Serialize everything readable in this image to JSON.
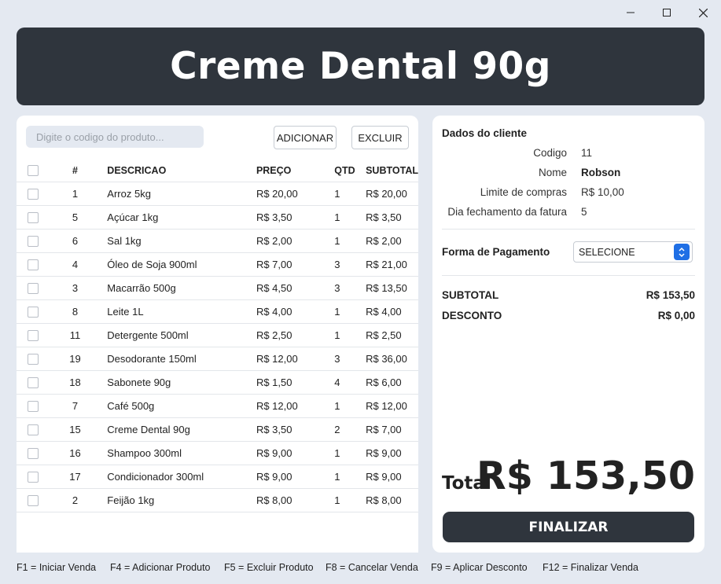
{
  "window": {
    "minimize_icon": "minimize-icon",
    "maximize_icon": "maximize-icon",
    "close_icon": "close-icon"
  },
  "header": {
    "title": "Creme Dental 90g"
  },
  "search": {
    "placeholder": "Digite o codigo do produto...",
    "value": ""
  },
  "toolbar": {
    "add_label": "ADICIONAR",
    "delete_label": "EXCLUIR"
  },
  "table": {
    "columns": [
      "#",
      "DESCRICAO",
      "PREÇO",
      "QTD",
      "SUBTOTAL"
    ],
    "rows": [
      {
        "num": "1",
        "desc": "Arroz 5kg",
        "price": "R$ 20,00",
        "qtd": "1",
        "subtotal": "R$ 20,00"
      },
      {
        "num": "5",
        "desc": "Açúcar 1kg",
        "price": "R$ 3,50",
        "qtd": "1",
        "subtotal": "R$ 3,50"
      },
      {
        "num": "6",
        "desc": "Sal 1kg",
        "price": "R$ 2,00",
        "qtd": "1",
        "subtotal": "R$ 2,00"
      },
      {
        "num": "4",
        "desc": "Óleo de Soja 900ml",
        "price": "R$ 7,00",
        "qtd": "3",
        "subtotal": "R$ 21,00"
      },
      {
        "num": "3",
        "desc": "Macarrão 500g",
        "price": "R$ 4,50",
        "qtd": "3",
        "subtotal": "R$ 13,50"
      },
      {
        "num": "8",
        "desc": "Leite 1L",
        "price": "R$ 4,00",
        "qtd": "1",
        "subtotal": "R$ 4,00"
      },
      {
        "num": "11",
        "desc": "Detergente 500ml",
        "price": "R$ 2,50",
        "qtd": "1",
        "subtotal": "R$ 2,50"
      },
      {
        "num": "19",
        "desc": "Desodorante 150ml",
        "price": "R$ 12,00",
        "qtd": "3",
        "subtotal": "R$ 36,00"
      },
      {
        "num": "18",
        "desc": "Sabonete 90g",
        "price": "R$ 1,50",
        "qtd": "4",
        "subtotal": "R$ 6,00"
      },
      {
        "num": "7",
        "desc": "Café 500g",
        "price": "R$ 12,00",
        "qtd": "1",
        "subtotal": "R$ 12,00"
      },
      {
        "num": "15",
        "desc": "Creme Dental 90g",
        "price": "R$ 3,50",
        "qtd": "2",
        "subtotal": "R$ 7,00"
      },
      {
        "num": "16",
        "desc": "Shampoo 300ml",
        "price": "R$ 9,00",
        "qtd": "1",
        "subtotal": "R$ 9,00"
      },
      {
        "num": "17",
        "desc": "Condicionador 300ml",
        "price": "R$ 9,00",
        "qtd": "1",
        "subtotal": "R$ 9,00"
      },
      {
        "num": "2",
        "desc": "Feijão 1kg",
        "price": "R$ 8,00",
        "qtd": "1",
        "subtotal": "R$ 8,00"
      }
    ]
  },
  "client": {
    "title": "Dados do cliente",
    "fields": [
      {
        "label": "Codigo",
        "value": "11"
      },
      {
        "label": "Nome",
        "value": "Robson"
      },
      {
        "label": "Limite de compras",
        "value": "R$ 10,00"
      },
      {
        "label": "Dia fechamento da fatura",
        "value": "5"
      }
    ]
  },
  "payment": {
    "label": "Forma de Pagamento",
    "selected": "SELECIONE"
  },
  "summary": {
    "subtotal_label": "SUBTOTAL",
    "subtotal_value": "R$ 153,50",
    "discount_label": "DESCONTO",
    "discount_value": "R$ 0,00"
  },
  "total": {
    "label": "Total",
    "value": "R$ 153,50"
  },
  "finalize_label": "FINALIZAR",
  "shortcuts": [
    "F1 = Iniciar Venda",
    "F4 = Adicionar Produto",
    "F5 = Excluir Produto",
    "F8 = Cancelar Venda",
    "F9 = Aplicar Desconto",
    "F12 = Finalizar Venda"
  ],
  "colors": {
    "header_bg": "#2f353d",
    "page_bg": "#e4e9f1",
    "accent_select": "#1f6fe5"
  }
}
